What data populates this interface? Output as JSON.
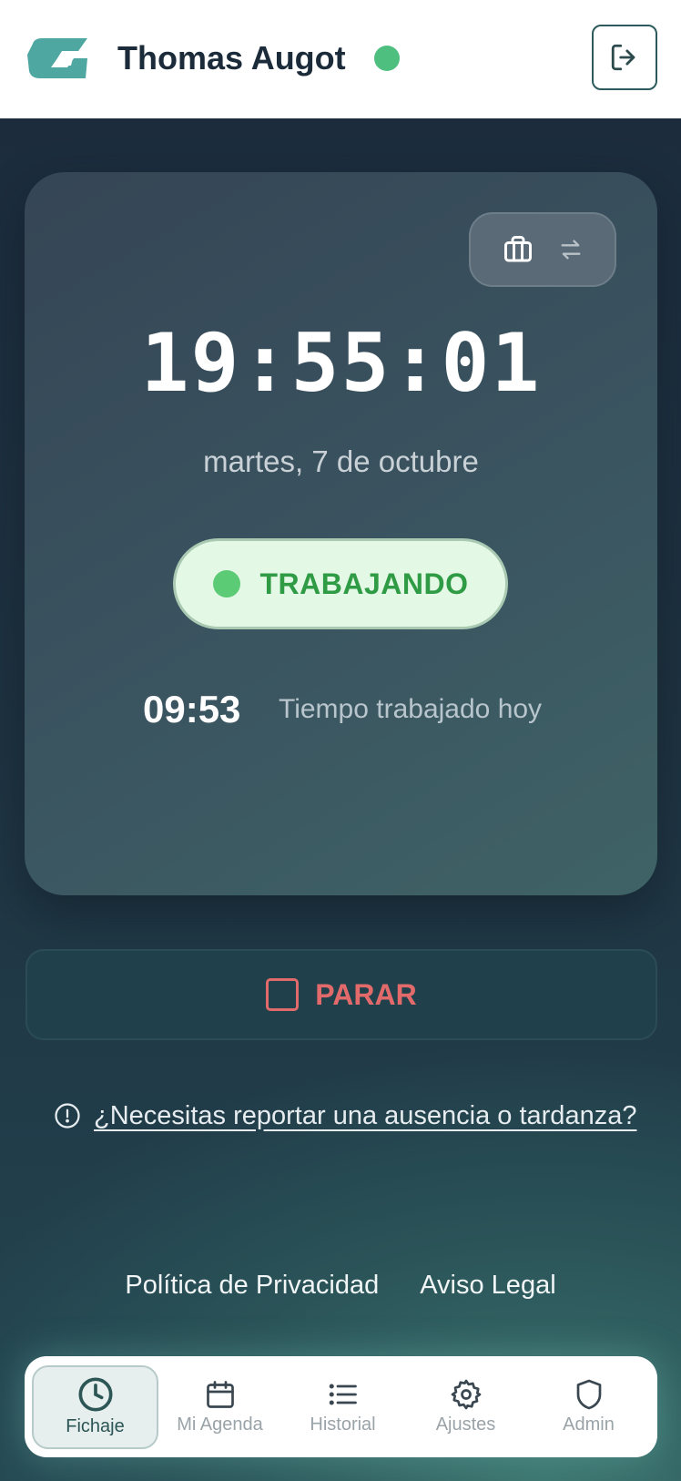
{
  "header": {
    "user_name": "Thomas Augot",
    "status": "online"
  },
  "clock": {
    "time": "19:55:01",
    "date": "martes, 7 de octubre",
    "status_label": "TRABAJANDO",
    "worked_time": "09:53",
    "worked_label": "Tiempo trabajado hoy",
    "mode_icons": [
      "briefcase-icon",
      "swap-arrows-icon"
    ]
  },
  "actions": {
    "stop_label": "PARAR",
    "absence_link": "¿Necesitas reportar una ausencia o tardanza?"
  },
  "footer": {
    "privacy": "Política de Privacidad",
    "legal": "Aviso Legal"
  },
  "nav": {
    "items": [
      {
        "label": "Fichaje",
        "icon": "clock-icon",
        "active": true
      },
      {
        "label": "Mi Agenda",
        "icon": "calendar-icon",
        "active": false
      },
      {
        "label": "Historial",
        "icon": "list-icon",
        "active": false
      },
      {
        "label": "Ajustes",
        "icon": "gear-icon",
        "active": false
      },
      {
        "label": "Admin",
        "icon": "shield-icon",
        "active": false
      }
    ]
  },
  "colors": {
    "accent": "#4fa7a1",
    "online": "#4fbf7f",
    "working": "#2f9b45",
    "stop": "#e26a6a"
  }
}
